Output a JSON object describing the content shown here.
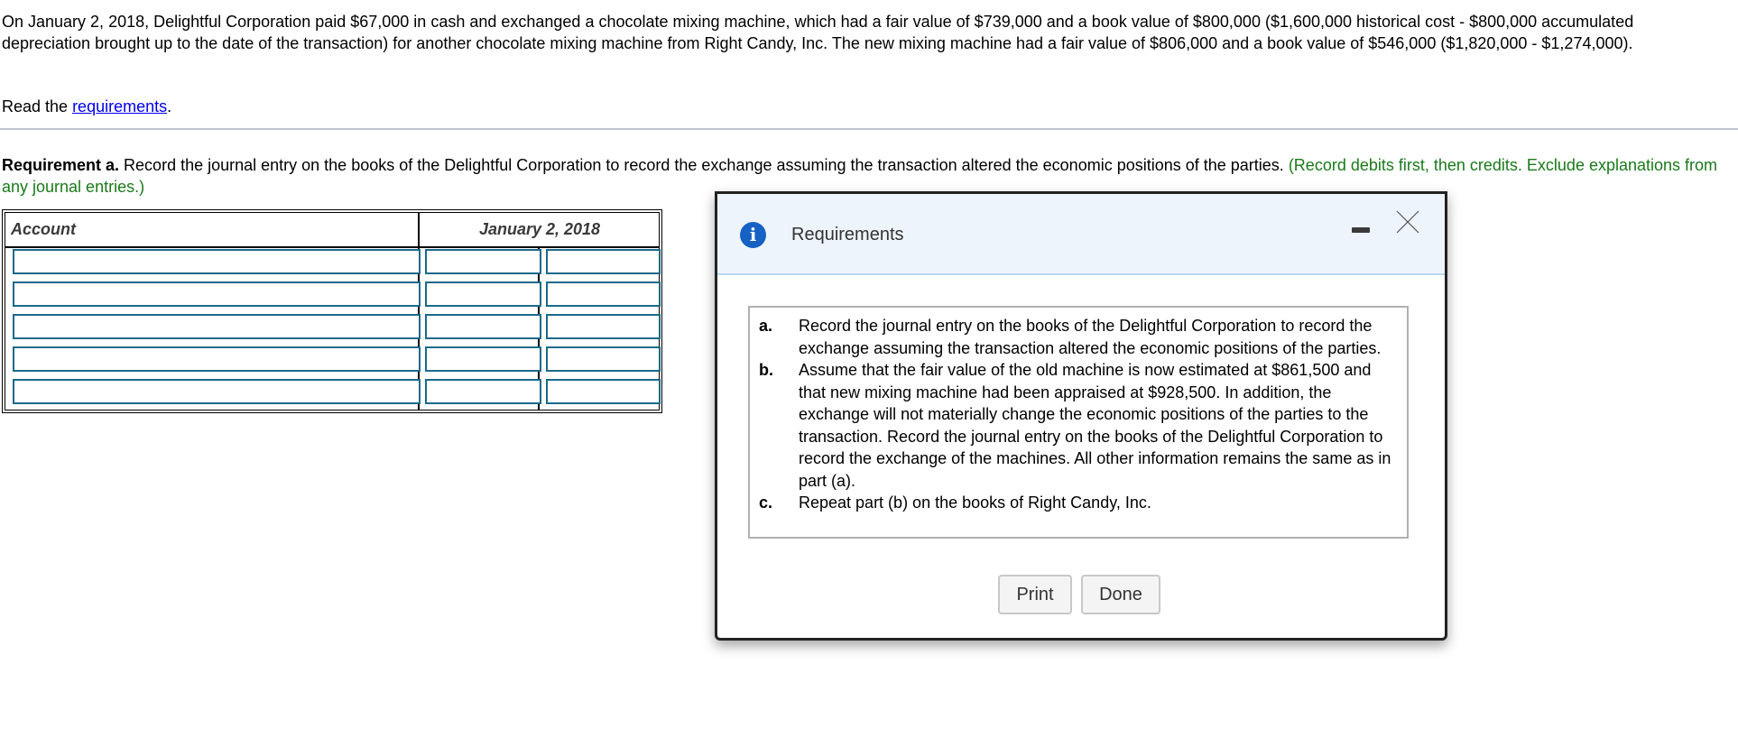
{
  "intro": {
    "text": "On January 2, 2018, Delightful Corporation paid $67,000 in cash and exchanged a chocolate mixing machine, which had a fair value of $739,000 and a book value of $800,000 ($1,600,000 historical cost - $800,000 accumulated depreciation brought up to the date of the transaction) for another chocolate mixing machine from Right Candy, Inc. The new mixing machine had a fair value of $806,000 and a book value of $546,000 ($1,820,000 - $1,274,000)."
  },
  "read_requirements": {
    "prefix": "Read the ",
    "link": "requirements",
    "suffix": "."
  },
  "requirement_a": {
    "label": "Requirement a.",
    "text": " Record the journal entry on the books of the Delightful Corporation to record the exchange assuming the transaction altered the economic positions of the parties. ",
    "instruction": "(Record debits first, then credits. Exclude explanations from any journal entries.)"
  },
  "journal": {
    "headers": {
      "account": "Account",
      "date": "January 2, 2018"
    },
    "rows": [
      {
        "account": "",
        "debit": "",
        "credit": ""
      },
      {
        "account": "",
        "debit": "",
        "credit": ""
      },
      {
        "account": "",
        "debit": "",
        "credit": ""
      },
      {
        "account": "",
        "debit": "",
        "credit": ""
      },
      {
        "account": "",
        "debit": "",
        "credit": ""
      }
    ]
  },
  "modal": {
    "icon": "info-icon",
    "info_glyph": "i",
    "title": "Requirements",
    "items": [
      {
        "letter": "a.",
        "text": "Record the journal entry on the books of the Delightful Corporation to record the exchange assuming the transaction altered the economic positions of the parties."
      },
      {
        "letter": "b.",
        "text": "Assume that the fair value of the old machine is now estimated at $861,500 and that new mixing machine had been appraised at $928,500. In addition, the exchange will not materially change the economic positions of the parties to the transaction. Record the journal entry on the books of the Delightful Corporation to record the exchange of the machines. All other information remains the same as in part (a)."
      },
      {
        "letter": "c.",
        "text": "Repeat part (b) on the books of Right Candy, Inc."
      }
    ],
    "buttons": {
      "print": "Print",
      "done": "Done"
    }
  },
  "colors": {
    "link": "#0000ee",
    "instruction_green": "#1a7a1a",
    "input_border": "#1b6a8a",
    "info_icon": "#1561c4",
    "modal_header_bg": "#eef4fc"
  }
}
